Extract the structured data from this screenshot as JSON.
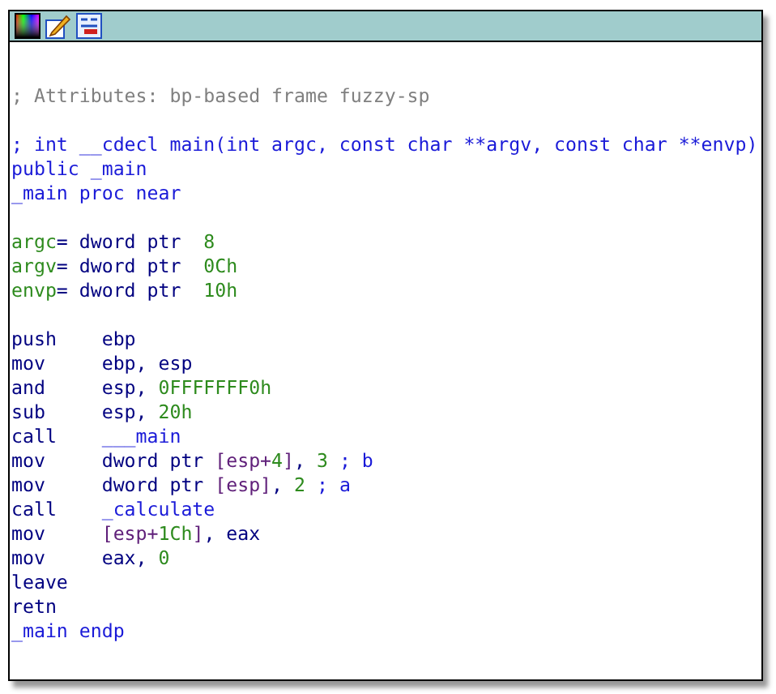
{
  "toolbar": {
    "icons": [
      {
        "kind": "palette"
      },
      {
        "kind": "pencil"
      },
      {
        "kind": "graph"
      }
    ]
  },
  "blocks": [
    [
      {
        "segments": [
          {
            "kind": "comment",
            "text": "; Attributes: bp-based frame fuzzy-sp"
          }
        ]
      }
    ],
    [
      {
        "segments": [
          {
            "kind": "name",
            "text": "; int __cdecl main(int argc, const char **argv, const char **envp)"
          }
        ]
      },
      {
        "segments": [
          {
            "kind": "name",
            "text": "public _main"
          }
        ]
      },
      {
        "segments": [
          {
            "kind": "name",
            "text": "_main proc near"
          }
        ]
      }
    ],
    [
      {
        "segments": [
          {
            "kind": "var",
            "text": "argc"
          },
          {
            "kind": "plain",
            "text": "= dword ptr  "
          },
          {
            "kind": "number",
            "text": "8"
          }
        ]
      },
      {
        "segments": [
          {
            "kind": "var",
            "text": "argv"
          },
          {
            "kind": "plain",
            "text": "= dword ptr  "
          },
          {
            "kind": "number",
            "text": "0Ch"
          }
        ]
      },
      {
        "segments": [
          {
            "kind": "var",
            "text": "envp"
          },
          {
            "kind": "plain",
            "text": "= dword ptr  "
          },
          {
            "kind": "number",
            "text": "10h"
          }
        ]
      }
    ],
    [
      {
        "segments": [
          {
            "kind": "plain",
            "text": "push    ebp"
          }
        ]
      },
      {
        "segments": [
          {
            "kind": "plain",
            "text": "mov     ebp, esp"
          }
        ]
      },
      {
        "segments": [
          {
            "kind": "plain",
            "text": "and     esp, "
          },
          {
            "kind": "number",
            "text": "0FFFFFFF0h"
          }
        ]
      },
      {
        "segments": [
          {
            "kind": "plain",
            "text": "sub     esp, "
          },
          {
            "kind": "number",
            "text": "20h"
          }
        ]
      },
      {
        "segments": [
          {
            "kind": "plain",
            "text": "call    "
          },
          {
            "kind": "name",
            "text": "___main"
          }
        ]
      },
      {
        "segments": [
          {
            "kind": "plain",
            "text": "mov     dword ptr "
          },
          {
            "kind": "memref",
            "text": "[esp+"
          },
          {
            "kind": "number",
            "text": "4"
          },
          {
            "kind": "memref",
            "text": "]"
          },
          {
            "kind": "plain",
            "text": ", "
          },
          {
            "kind": "number",
            "text": "3"
          },
          {
            "kind": "name",
            "text": " ; b"
          }
        ]
      },
      {
        "segments": [
          {
            "kind": "plain",
            "text": "mov     dword ptr "
          },
          {
            "kind": "memref",
            "text": "[esp]"
          },
          {
            "kind": "plain",
            "text": ", "
          },
          {
            "kind": "number",
            "text": "2"
          },
          {
            "kind": "name",
            "text": " ; a"
          }
        ]
      },
      {
        "segments": [
          {
            "kind": "plain",
            "text": "call    "
          },
          {
            "kind": "name",
            "text": "_calculate"
          }
        ]
      },
      {
        "segments": [
          {
            "kind": "plain",
            "text": "mov     "
          },
          {
            "kind": "memref",
            "text": "[esp+"
          },
          {
            "kind": "number",
            "text": "1Ch"
          },
          {
            "kind": "memref",
            "text": "]"
          },
          {
            "kind": "plain",
            "text": ", eax"
          }
        ]
      },
      {
        "segments": [
          {
            "kind": "plain",
            "text": "mov     eax, "
          },
          {
            "kind": "number",
            "text": "0"
          }
        ]
      },
      {
        "segments": [
          {
            "kind": "plain",
            "text": "leave"
          }
        ]
      },
      {
        "segments": [
          {
            "kind": "plain",
            "text": "retn"
          }
        ]
      },
      {
        "segments": [
          {
            "kind": "name",
            "text": "_main endp"
          }
        ]
      }
    ]
  ]
}
